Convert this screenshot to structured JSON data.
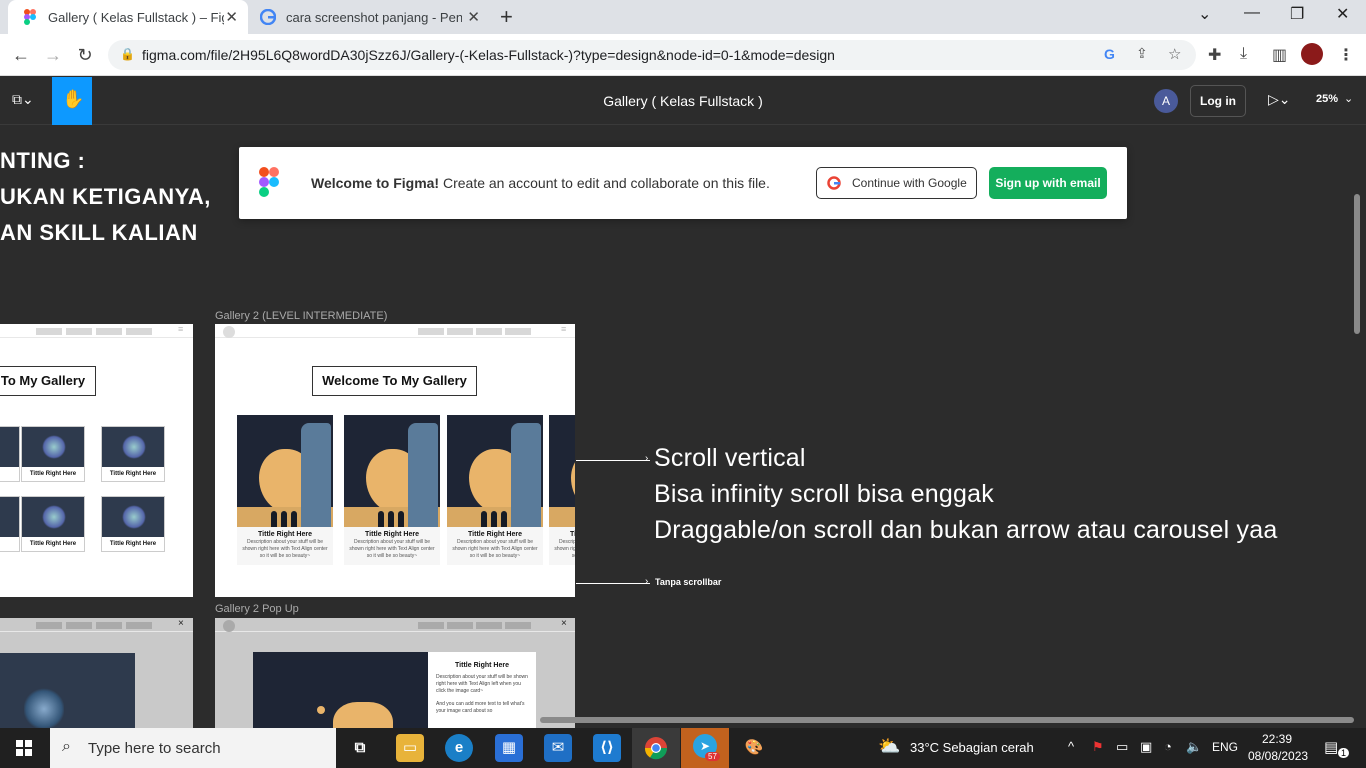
{
  "browser": {
    "tabs": [
      {
        "title": "Gallery ( Kelas Fullstack ) – Figma",
        "active": true
      },
      {
        "title": "cara screenshot panjang - Penelu",
        "active": false
      }
    ],
    "new_tab": "+",
    "url": "figma.com/file/2H95L6Q8wordDA30jSzz6J/Gallery-(-Kelas-Fullstack-)?type=design&node-id=0-1&mode=design"
  },
  "figma": {
    "file_title": "Gallery ( Kelas Fullstack )",
    "avatar_initial": "A",
    "login_label": "Log in",
    "zoom": "25%"
  },
  "banner": {
    "bold": "Welcome to Figma!",
    "text": " Create an account to edit and collaborate on this file.",
    "google_label": "Continue with Google",
    "email_label": "Sign up with email"
  },
  "canvas": {
    "left_text": [
      "NTING :",
      "UKAN KETIGANYA,",
      "AN  SKILL KALIAN"
    ],
    "frame_gallery2_label": "Gallery 2 (LEVEL INTERMEDIATE)",
    "frame_popup_label": "Gallery 2 Pop Up",
    "gallery_heading": "Welcome To My Gallery",
    "gallery_heading_left": "To My Gallery",
    "card_title": "Tittle Right Here",
    "card_desc": "Description about your stuff will be shown right here with Text Align center so it will be so beauty~",
    "mini_title": "Tittle Right Here",
    "popup_title": "Tittle Right Here",
    "popup_desc": "Description about your stuff will be shown right here with Text Align left when you click the image card~",
    "popup_desc2": "And you can add more text to tell what's your image card about so",
    "popup_close": "×",
    "annotations": [
      "Scroll vertical",
      "Bisa infinity scroll bisa enggak",
      "Draggable/on scroll dan bukan arrow atau carousel yaa"
    ],
    "note_scrollbar": "Tanpa scrollbar"
  },
  "taskbar": {
    "search_placeholder": "Type here to search",
    "weather": "33°C  Sebagian cerah",
    "lang": "ENG",
    "time": "22:39",
    "date": "08/08/2023",
    "telegram_badge": "57",
    "notif_count": "1"
  },
  "colors": {
    "figma_bg": "#2c2c2c",
    "figma_accent": "#0d99ff",
    "signup_green": "#14ae5c"
  }
}
